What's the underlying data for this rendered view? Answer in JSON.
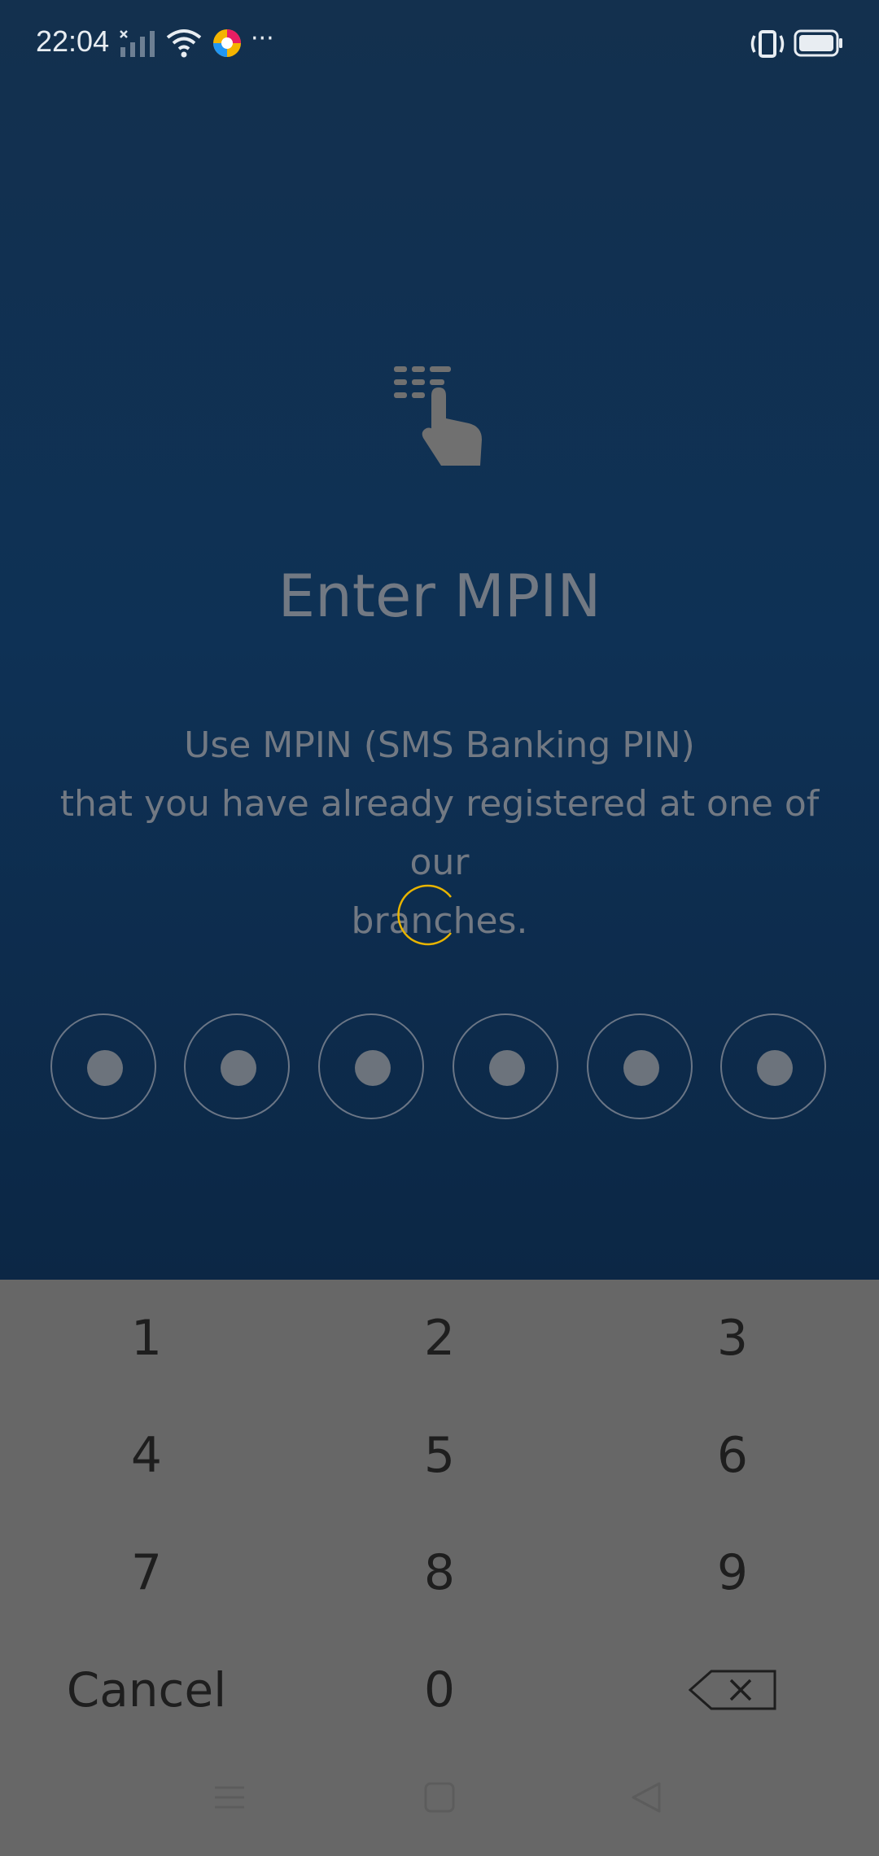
{
  "status_bar": {
    "time": "22:04",
    "icons": [
      "signal-icon",
      "wifi-icon",
      "app-notification-icon",
      "more-icon",
      "vibrate-icon",
      "battery-icon"
    ],
    "more": "···"
  },
  "screen": {
    "icon": "tap-keypad-icon",
    "title": "Enter MPIN",
    "description_line1": "Use MPIN (SMS Banking PIN)",
    "description_line2": "that you have already registered at one of our",
    "description_line3": "branches.",
    "spinner_color": "#e8b400",
    "pin_length": 6,
    "pin_filled": 6
  },
  "keypad": {
    "keys": [
      "1",
      "2",
      "3",
      "4",
      "5",
      "6",
      "7",
      "8",
      "9"
    ],
    "cancel_label": "Cancel",
    "zero": "0",
    "backspace_icon": "backspace-icon"
  },
  "nav_bar": {
    "icons": [
      "menu-icon",
      "home-icon",
      "back-icon"
    ]
  },
  "colors": {
    "background_top": "#0e3155",
    "keypad_background": "#676767",
    "text_muted": "#727983"
  }
}
